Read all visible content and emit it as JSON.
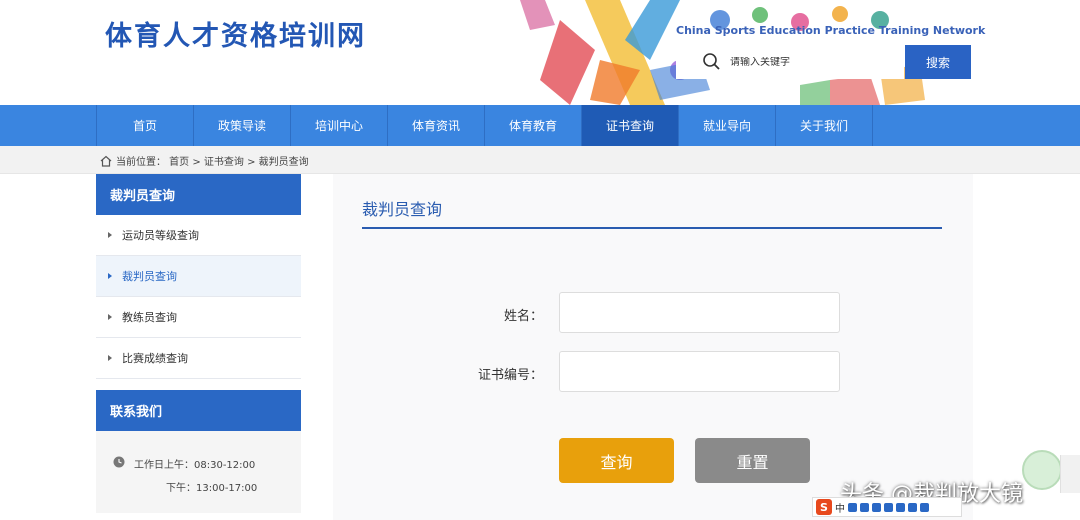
{
  "header": {
    "site_title": "体育人才资格培训网",
    "site_subtitle": "China Sports Education Practice Training Network",
    "search_placeholder": "请输入关键字",
    "search_button": "搜索"
  },
  "nav": {
    "items": [
      {
        "label": "首页",
        "active": false
      },
      {
        "label": "政策导读",
        "active": false
      },
      {
        "label": "培训中心",
        "active": false
      },
      {
        "label": "体育资讯",
        "active": false
      },
      {
        "label": "体育教育",
        "active": false
      },
      {
        "label": "证书查询",
        "active": true
      },
      {
        "label": "就业导向",
        "active": false
      },
      {
        "label": "关于我们",
        "active": false
      }
    ]
  },
  "breadcrumb": {
    "text": "当前位置： 首页 > 证书查询 > 裁判员查询"
  },
  "sidebar": {
    "heading": "裁判员查询",
    "items": [
      {
        "label": "运动员等级查询",
        "active": false
      },
      {
        "label": "裁判员查询",
        "active": true
      },
      {
        "label": "教练员查询",
        "active": false
      },
      {
        "label": "比赛成绩查询",
        "active": false
      }
    ],
    "contact_heading": "联系我们",
    "hours_line1": "工作日上午：08:30-12:00",
    "hours_line2": "下午：13:00-17:00"
  },
  "main": {
    "title": "裁判员查询",
    "name_label": "姓名：",
    "cert_label": "证书编号：",
    "query_button": "查询",
    "reset_button": "重置"
  },
  "overlay": {
    "watermark": "头条 @裁判放大镜",
    "ime_label": "中"
  },
  "colors": {
    "brand_blue": "#2357b4",
    "nav_blue": "#3a85e0",
    "nav_active": "#1f5bb5",
    "query_orange": "#e8a00c",
    "reset_gray": "#8a8a8a"
  }
}
